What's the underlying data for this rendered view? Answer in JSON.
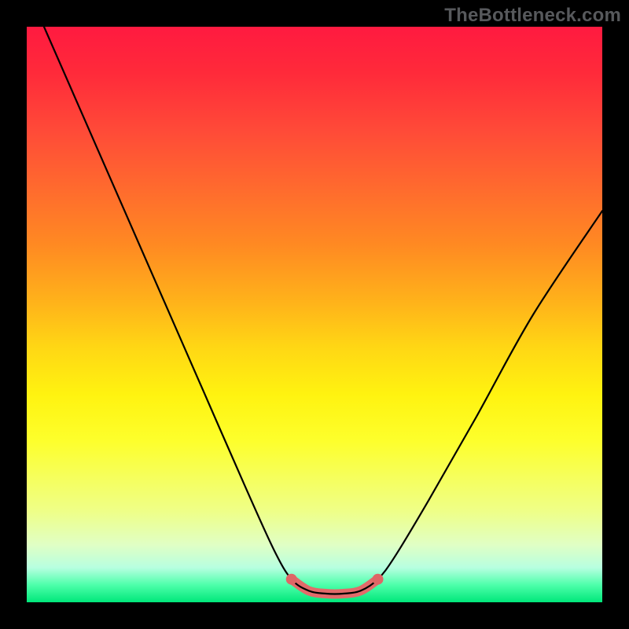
{
  "watermark": "TheBottleneck.com",
  "chart_data": {
    "type": "line",
    "title": "",
    "xlabel": "",
    "ylabel": "",
    "xlim": [
      0,
      100
    ],
    "ylim": [
      0,
      100
    ],
    "series": [
      {
        "name": "bottleneck-curve",
        "x": [
          3,
          10,
          17,
          24,
          31,
          38,
          43,
          46,
          49,
          52,
          55,
          58,
          61,
          64,
          70,
          78,
          88,
          100
        ],
        "values": [
          100,
          84,
          68,
          52,
          36,
          20,
          9,
          4,
          2,
          1.5,
          1.5,
          2,
          4,
          8,
          18,
          32,
          50,
          68
        ]
      }
    ],
    "highlight_range_x": [
      46,
      61
    ],
    "gradient_scale": "bottleneck-severity",
    "grid": false,
    "axes_visible": false
  }
}
